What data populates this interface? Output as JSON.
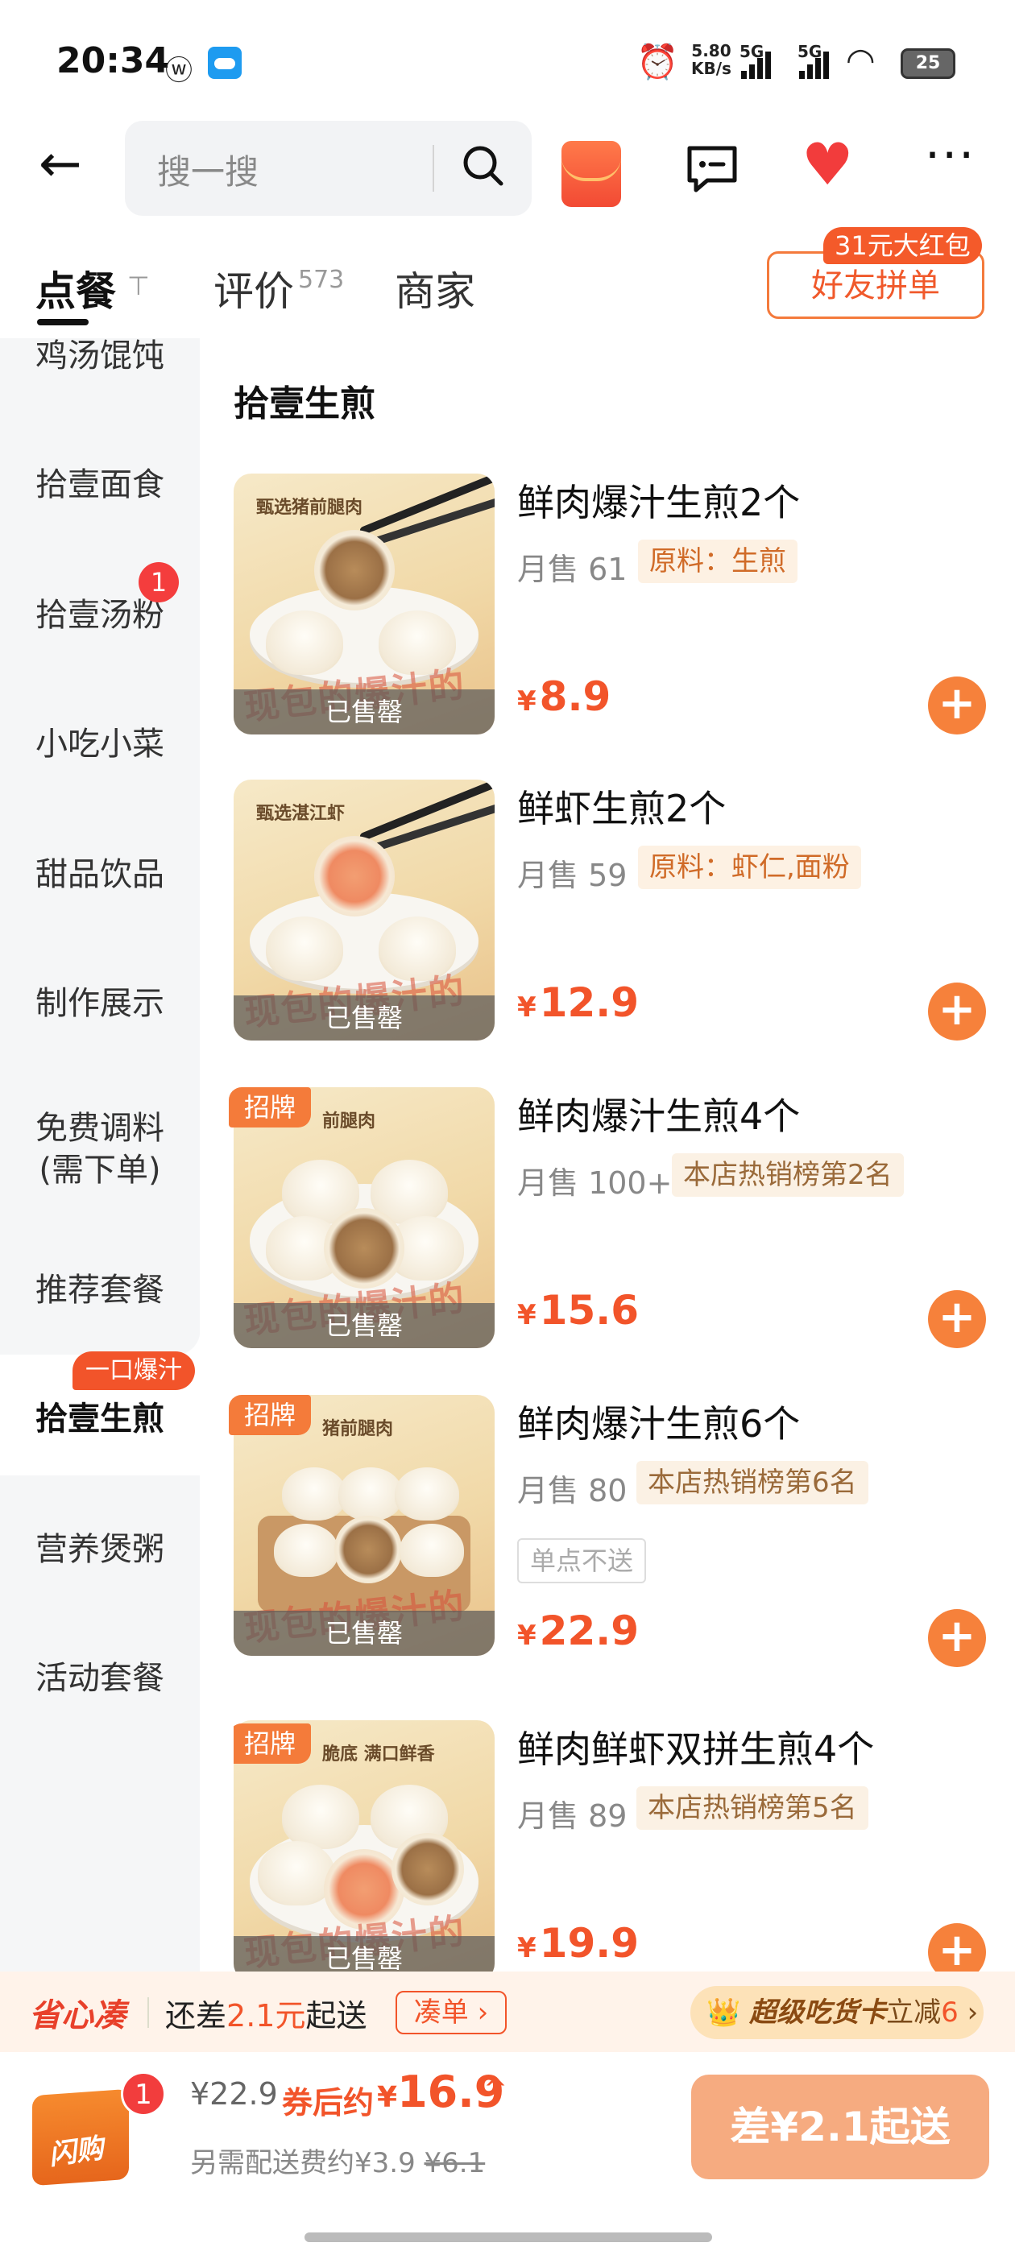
{
  "status_bar": {
    "time": "20:34",
    "net_speed_value": "5.80",
    "net_speed_unit": "KB/s",
    "sig1": "5G",
    "sig2": "5G",
    "battery": "25"
  },
  "header": {
    "search_placeholder": "搜一搜"
  },
  "tabs": {
    "order": "点餐",
    "reviews": "评价",
    "reviews_count": "573",
    "merchant": "商家",
    "group_order": "好友拼单",
    "group_badge": "31元大红包"
  },
  "sidebar": {
    "items": [
      "鸡汤馄饨",
      "拾壹面食",
      "拾壹汤粉",
      "小吃小菜",
      "甜品饮品",
      "制作展示",
      "免费调料\n(需下单)",
      "推荐套餐",
      "拾壹生煎",
      "营养煲粥",
      "活动套餐"
    ],
    "badge_soup": "1",
    "active_tag": "一口爆汁"
  },
  "section_title": "拾壹生煎",
  "products": [
    {
      "name": "鲜肉爆汁生煎2个",
      "sales": "月售 61",
      "tag": "原料：生煎",
      "price": "8.9",
      "sold_out": "已售罄",
      "image_caption": "甄选猪前腿肉",
      "image_slogan": "现包的爆汁的"
    },
    {
      "name": "鲜虾生煎2个",
      "sales": "月售 59",
      "tag": "原料：虾仁,面粉",
      "price": "12.9",
      "sold_out": "已售罄",
      "image_caption": "甄选湛江虾",
      "image_slogan": "现包的爆汁的"
    },
    {
      "name": "鲜肉爆汁生煎4个",
      "sales": "月售 100+",
      "tag": "本店热销榜第2名",
      "price": "15.6",
      "sold_out": "已售罄",
      "badge": "招牌",
      "image_caption": "前腿肉",
      "image_slogan": "现包的爆汁的"
    },
    {
      "name": "鲜肉爆汁生煎6个",
      "sales": "月售 80",
      "tag": "本店热销榜第6名",
      "note": "单点不送",
      "price": "22.9",
      "sold_out": "已售罄",
      "badge": "招牌",
      "image_caption": "猪前腿肉",
      "image_slogan": "现包的爆汁的"
    },
    {
      "name": "鲜肉鲜虾双拼生煎4个",
      "sales": "月售 89",
      "tag": "本店热销榜第5名",
      "price": "19.9",
      "sold_out": "已售罄",
      "badge": "招牌",
      "image_caption": "脆底 满口鲜香",
      "image_slogan": "现包的爆汁的"
    }
  ],
  "currency": "¥",
  "promo": {
    "logo": "省心凑",
    "text_prefix": "还差",
    "amount": "2.1元",
    "text_suffix": "起送",
    "button": "凑单 ›",
    "card_name": "超级吃货卡",
    "card_text": "立减",
    "card_amount": "6",
    "card_arrow": "›"
  },
  "cart": {
    "bag_label": "闪购",
    "count": "1",
    "original_price": "¥22.9",
    "after_label": "券后约",
    "after_price": "16.9",
    "caret": "^",
    "delivery_label": "另需配送费约¥3.9",
    "delivery_original": "¥6.1",
    "checkout": "差¥2.1起送"
  },
  "colors": {
    "accent": "#f2542a",
    "add_button": "#f6813b",
    "checkout_button": "#f6ab80",
    "heart": "#f23c3c"
  }
}
